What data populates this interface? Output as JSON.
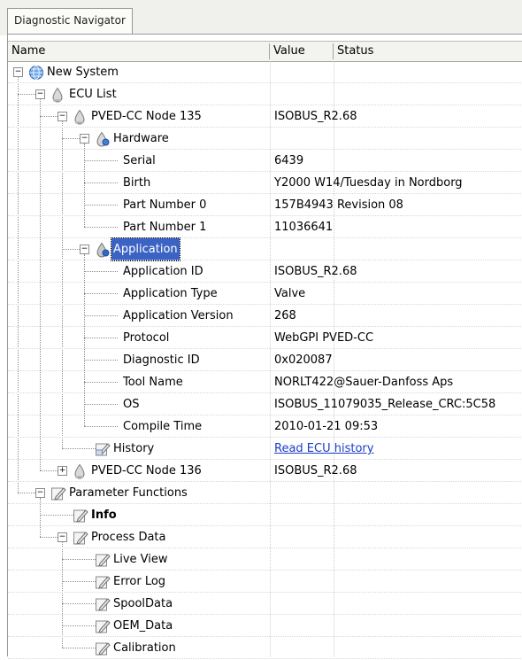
{
  "tab": {
    "label": "Diagnostic Navigator"
  },
  "columns": [
    "Name",
    "Value",
    "Status"
  ],
  "rows": [
    {
      "label": "New System",
      "value": ""
    },
    {
      "label": "ECU List",
      "value": ""
    },
    {
      "label": "PVED-CC Node 135",
      "value": "ISOBUS_R2.68"
    },
    {
      "label": "Hardware",
      "value": ""
    },
    {
      "label": "Serial",
      "value": "6439"
    },
    {
      "label": "Birth",
      "value": "Y2000 W14/Tuesday in Nordborg"
    },
    {
      "label": "Part Number 0",
      "value": "157B4943 Revision 08"
    },
    {
      "label": "Part Number 1",
      "value": "11036641"
    },
    {
      "label": "Application",
      "value": ""
    },
    {
      "label": "Application ID",
      "value": "ISOBUS_R2.68"
    },
    {
      "label": "Application Type",
      "value": "Valve"
    },
    {
      "label": "Application Version",
      "value": "268"
    },
    {
      "label": "Protocol",
      "value": "WebGPI PVED-CC"
    },
    {
      "label": "Diagnostic ID",
      "value": "0x020087"
    },
    {
      "label": "Tool Name",
      "value": "NORLT422@Sauer-Danfoss Aps"
    },
    {
      "label": "OS",
      "value": "ISOBUS_11079035_Release_CRC:5C58"
    },
    {
      "label": "Compile Time",
      "value": "2010-01-21 09:53"
    },
    {
      "label": "History",
      "value": "Read ECU history"
    },
    {
      "label": "PVED-CC Node 136",
      "value": "ISOBUS_R2.68"
    },
    {
      "label": "Parameter Functions",
      "value": ""
    },
    {
      "label": "Info",
      "value": ""
    },
    {
      "label": "Process Data",
      "value": ""
    },
    {
      "label": "Live View",
      "value": ""
    },
    {
      "label": "Error Log",
      "value": ""
    },
    {
      "label": "SpoolData",
      "value": ""
    },
    {
      "label": "OEM_Data",
      "value": ""
    },
    {
      "label": "Calibration",
      "value": ""
    }
  ],
  "icons": {
    "globe": "globe-icon",
    "ecu": "ecu-drop-icon",
    "tool": "pencil-tool-icon"
  },
  "colors": {
    "selection": "#3b63c4",
    "link": "#1b3bc8"
  }
}
